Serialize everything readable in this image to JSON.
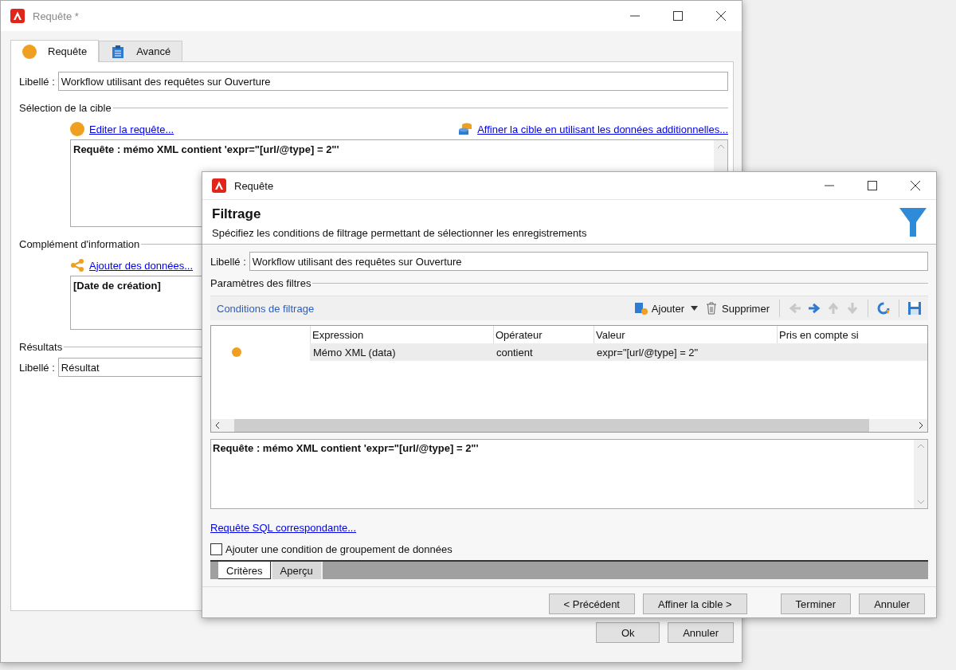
{
  "back_window": {
    "title": "Requête *",
    "tabs": [
      {
        "label": "Requête",
        "kind": "dot",
        "selected": true
      },
      {
        "label": "Avancé",
        "kind": "clipboard",
        "selected": false
      }
    ],
    "label_field": {
      "label": "Libellé :",
      "value": "Workflow utilisant des requêtes sur Ouverture"
    },
    "target_section": {
      "title": "Sélection de la cible",
      "edit_link": "Editer la requête...",
      "refine_link": "Affiner la cible en utilisant les données additionnelles...",
      "query_text": "Requête : mémo XML contient 'expr=\"[url/@type] = 2\"'"
    },
    "info_section": {
      "title": "Complément d'information",
      "add_link": "Ajouter des données...",
      "content": "[Date de création]"
    },
    "results_section": {
      "title": "Résultats",
      "label": "Libellé :",
      "value": "Résultat"
    },
    "buttons": [
      "Ok",
      "Annuler"
    ]
  },
  "front_window": {
    "title": "Requête",
    "heading": "Filtrage",
    "subtitle": "Spécifiez les conditions de filtrage permettant de sélectionner les enregistrements",
    "label_field": {
      "label": "Libellé :",
      "value": "Workflow utilisant des requêtes sur Ouverture"
    },
    "section_title": "Paramètres des filtres",
    "toolbar": {
      "title": "Conditions de filtrage",
      "actions": [
        {
          "label": "Ajouter",
          "kind": "add"
        },
        {
          "label": "Supprimer",
          "kind": "delete"
        }
      ],
      "nav": [
        {
          "kind": "left",
          "disabled": true
        },
        {
          "kind": "right",
          "disabled": false
        },
        {
          "kind": "up",
          "disabled": true
        },
        {
          "kind": "down",
          "disabled": true
        }
      ]
    },
    "table": {
      "columns": [
        "Expression",
        "Opérateur",
        "Valeur",
        "Pris en compte si"
      ],
      "rows": [
        {
          "expression": "Mémo XML (data)",
          "operator": "contient",
          "value": "expr=\"[url/@type] = 2\"",
          "selected": true,
          "color": "#f0a020"
        }
      ]
    },
    "query_text": "Requête : mémo XML contient 'expr=\"[url/@type] = 2\"'",
    "sql_link": "Requête SQL correspondante...",
    "group_checkbox": {
      "label": "Ajouter une condition de groupement de données",
      "checked": false
    },
    "bottom_tabs": [
      {
        "label": "Critères",
        "selected": true
      },
      {
        "label": "Aperçu",
        "selected": false
      }
    ],
    "buttons": [
      "< Précédent",
      "Affiner la cible >",
      "Terminer",
      "Annuler"
    ]
  }
}
